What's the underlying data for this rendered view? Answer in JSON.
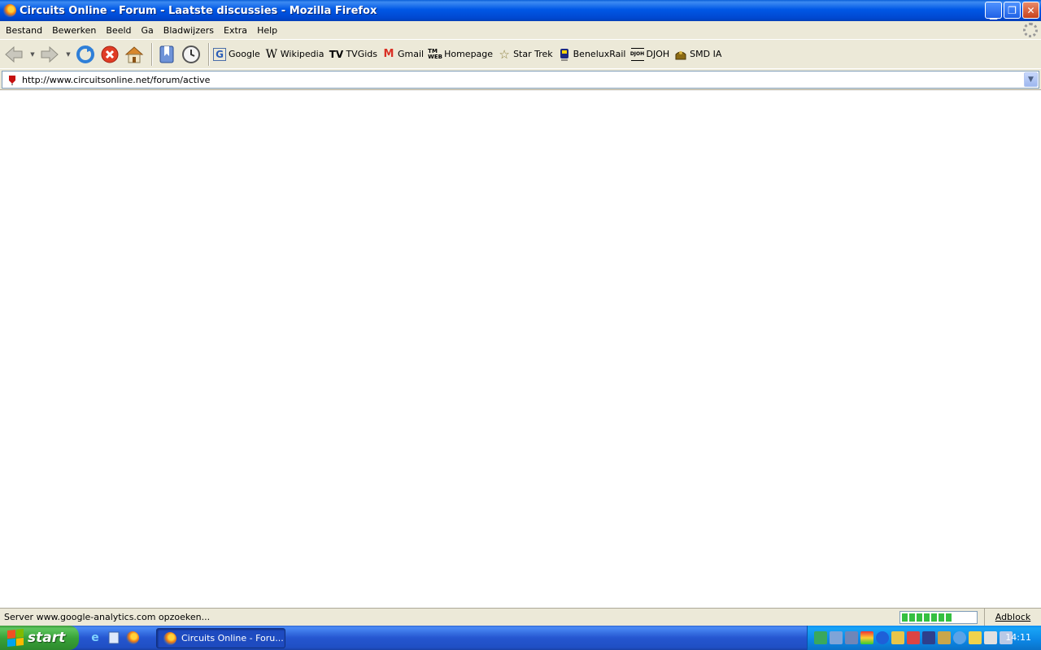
{
  "window": {
    "title": "Circuits Online - Forum - Laatste discussies - Mozilla Firefox"
  },
  "menu": [
    "Bestand",
    "Bewerken",
    "Beeld",
    "Ga",
    "Bladwijzers",
    "Extra",
    "Help"
  ],
  "bookmarks": [
    {
      "label": "Google",
      "icon": "google-icon"
    },
    {
      "label": "Wikipedia",
      "icon": "wikipedia-icon"
    },
    {
      "label": "TVGids",
      "icon": "tv-icon"
    },
    {
      "label": "Gmail",
      "icon": "gmail-icon"
    },
    {
      "label": "Homepage",
      "icon": "tm-web-icon"
    },
    {
      "label": "Star Trek",
      "icon": "star-icon"
    },
    {
      "label": "BeneluxRail",
      "icon": "train-icon"
    },
    {
      "label": "DJOH",
      "icon": "djoh-icon"
    },
    {
      "label": "SMD IA",
      "icon": "smd-icon"
    }
  ],
  "address": {
    "url": "http://www.circuitsonline.net/forum/active"
  },
  "status": {
    "text": "Server www.google-analytics.com opzoeken...",
    "progress_segments": 7,
    "adblock_label": "Adblock"
  },
  "taskbar": {
    "start_label": "start",
    "task_label": "Circuits Online - Foru...",
    "clock": "14:11"
  },
  "colors": {
    "titlebar": "#0058e6",
    "chrome": "#ece9d8",
    "progress": "#35c041",
    "start_green": "#39a339",
    "taskbar_blue": "#2556d0"
  }
}
